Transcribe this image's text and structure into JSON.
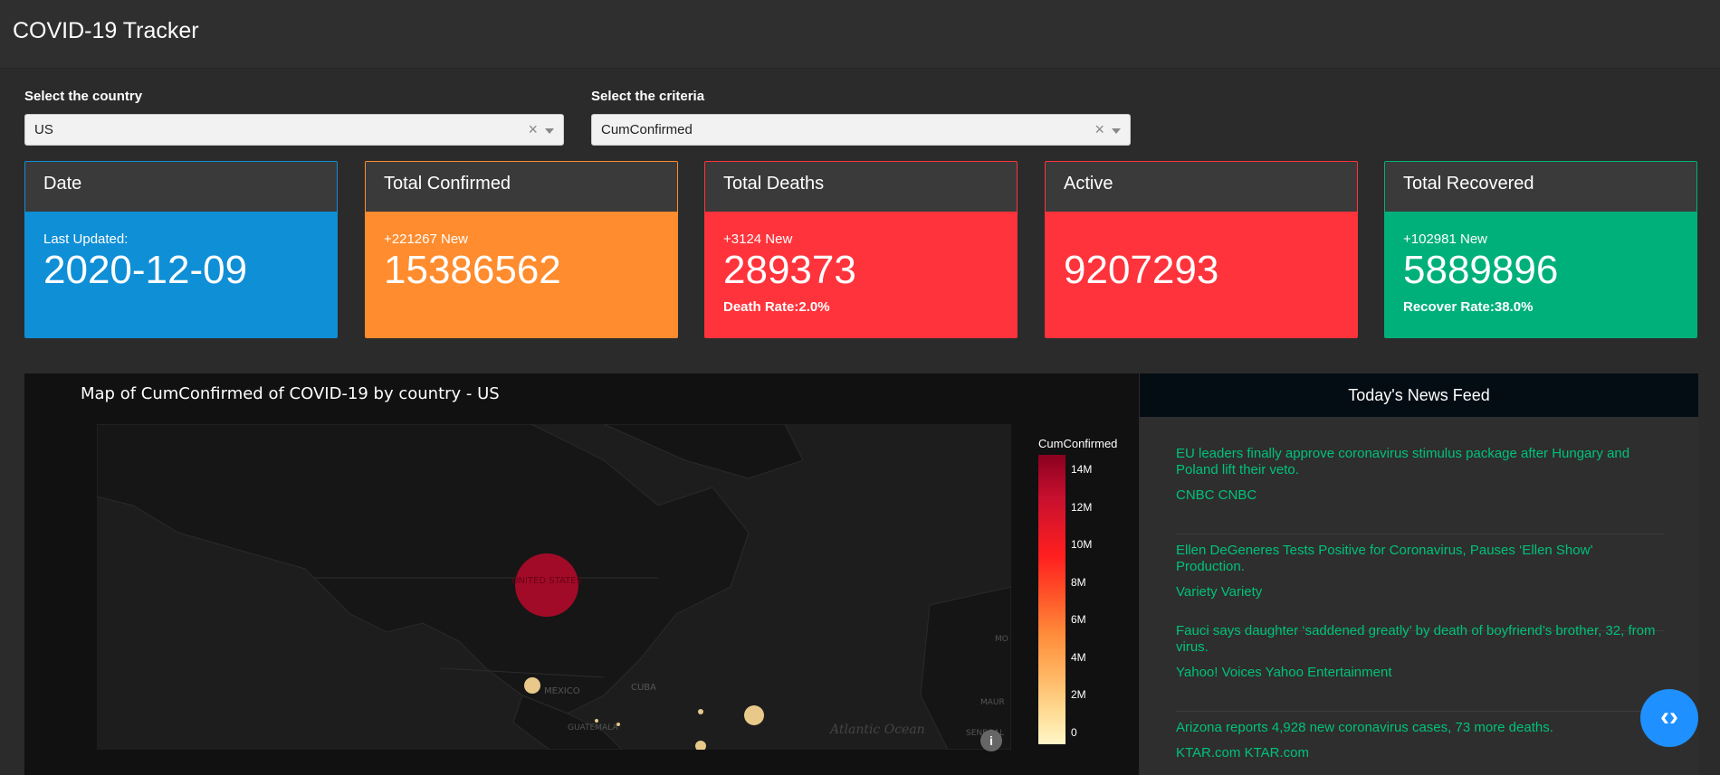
{
  "app": {
    "title": "COVID-19 Tracker"
  },
  "filters": {
    "country_label": "Select the country",
    "country_value": "US",
    "criteria_label": "Select the criteria",
    "criteria_value": "CumConfirmed",
    "clear_glyph": "×"
  },
  "cards": [
    {
      "title": "Date",
      "sub": "Last Updated:",
      "value": "2020-12-09",
      "foot": "",
      "bg": "#0f8fd6",
      "border": "#0f8fd6"
    },
    {
      "title": "Total Confirmed",
      "sub": "+221267 New",
      "value": "15386562",
      "foot": "",
      "bg": "#ff8c2e",
      "border": "#ff8c2e"
    },
    {
      "title": "Total Deaths",
      "sub": "+3124 New",
      "value": "289373",
      "foot": "Death Rate:2.0%",
      "bg": "#ff333b",
      "border": "#ff333b"
    },
    {
      "title": "Active",
      "sub": "",
      "value": "9207293",
      "foot": "",
      "bg": "#ff333b",
      "border": "#ff333b"
    },
    {
      "title": "Total Recovered",
      "sub": "+102981 New",
      "value": "5889896",
      "foot": "Recover Rate:38.0%",
      "bg": "#00b07a",
      "border": "#00b07a"
    }
  ],
  "map": {
    "title": "Map of CumConfirmed of COVID-19 by country - US",
    "colorbar_label": "CumConfirmed",
    "colorbar_ticks": [
      "14M",
      "12M",
      "10M",
      "8M",
      "6M",
      "4M",
      "2M",
      "0"
    ],
    "place_labels": {
      "us": "UNITED STATES",
      "mexico": "MEXICO",
      "cuba": "CUBA",
      "guatemala": "GUATEMALA",
      "atlantic": "Atlantic Ocean",
      "mau": "MAUR",
      "mo": "MO",
      "senegal": "SENEGAL"
    },
    "info_glyph": "i",
    "bubble_color_big": "#b00a2a",
    "bubble_color_small": "#e8c98a"
  },
  "news": {
    "header": "Today's News Feed",
    "items": [
      {
        "title": "EU leaders finally approve coronavirus stimulus package after Hungary and Poland lift their veto.",
        "source": "CNBC CNBC"
      },
      {
        "title": "Ellen DeGeneres Tests Positive for Coronavirus, Pauses ‘Ellen Show’ Production.",
        "source": "Variety Variety"
      },
      {
        "title": "Fauci says daughter ‘saddened greatly’ by death of boyfriend’s brother, 32, from virus.",
        "source": "Yahoo! Voices Yahoo Entertainment"
      },
      {
        "title": "Arizona reports 4,928 new coronavirus cases, 73 more deaths.",
        "source": "KTAR.com KTAR.com"
      }
    ]
  },
  "fab": {
    "glyph": "‹›"
  }
}
